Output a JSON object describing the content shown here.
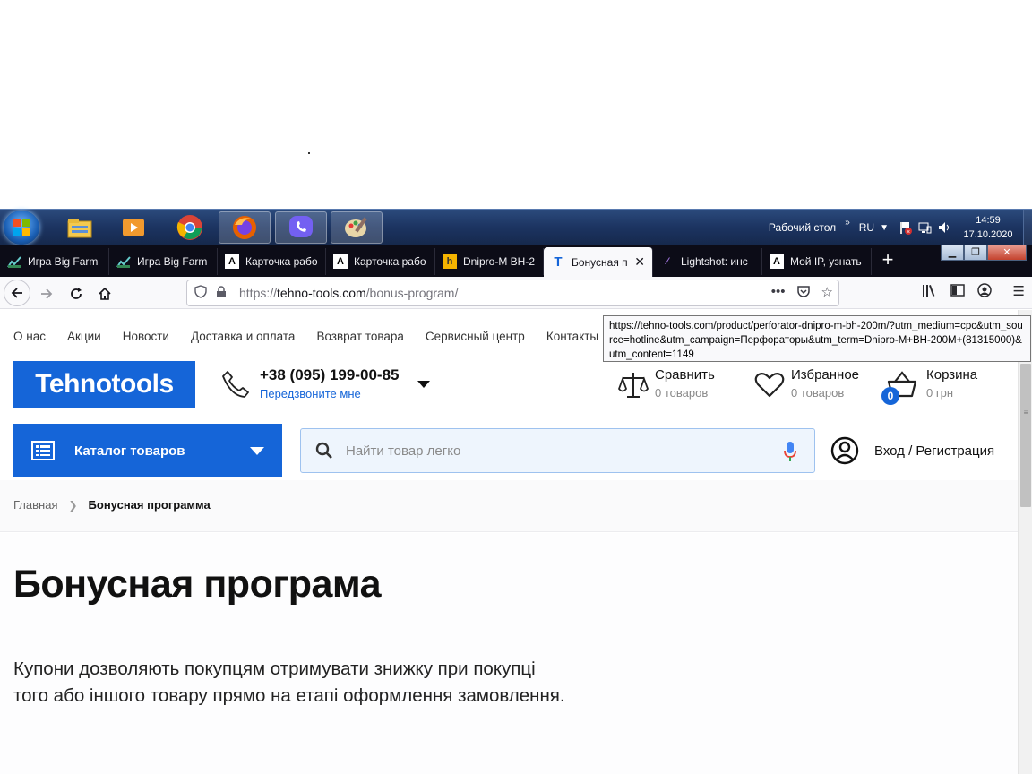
{
  "taskbar": {
    "desktop_label": "Рабочий стол",
    "lang": "RU",
    "time": "14:59",
    "date": "17.10.2020",
    "apps": [
      "explorer-icon",
      "media-player-icon",
      "chrome-icon",
      "firefox-icon",
      "viber-icon",
      "paint-icon"
    ]
  },
  "tabs": [
    {
      "label": "Игра Big Farm",
      "icon": "big-farm-icon"
    },
    {
      "label": "Игра Big Farm",
      "icon": "big-farm-icon"
    },
    {
      "label": "Карточка рабо",
      "icon": "a-icon"
    },
    {
      "label": "Карточка рабо",
      "icon": "a-icon"
    },
    {
      "label": "Dnipro-M BH-2",
      "icon": "h-icon"
    },
    {
      "label": "Бонусная п",
      "icon": "t-icon",
      "active": true
    },
    {
      "label": "Lightshot: инс",
      "icon": "feather-icon"
    },
    {
      "label": "Мой IP, узнать",
      "icon": "a-icon"
    }
  ],
  "urlbar": {
    "proto": "https://",
    "host": "tehno-tools.com",
    "path": "/bonus-program/"
  },
  "tooltip": {
    "text": "https://tehno-tools.com/product/perforator-dnipro-m-bh-200m/?utm_medium=cpc&utm_source=hotline&utm_campaign=Перфораторы&utm_term=Dnipro-M+BH-200M+(81315000)&utm_content=1149"
  },
  "site": {
    "menu": [
      "О нас",
      "Акции",
      "Новости",
      "Доставка и оплата",
      "Возврат товара",
      "Сервисный центр",
      "Контакты"
    ],
    "logo": "Tehnotools",
    "phone": "+38 (095) 199-00-85",
    "callback": "Передзвоните мне",
    "compare": {
      "title": "Сравнить",
      "sub": "0 товаров"
    },
    "favorites": {
      "title": "Избранное",
      "sub": "0 товаров"
    },
    "cart": {
      "title": "Корзина",
      "sub": "0 грн",
      "count": "0"
    },
    "catalog": "Каталог товаров",
    "search_placeholder": "Найти товар легко",
    "login": "Вход / Регистрация",
    "breadcrumb": {
      "home": "Главная",
      "current": "Бонусная программа"
    },
    "title": "Бонусная програма",
    "intro": "Купони дозволяють покупцям отримувати знижку при покупці того або іншого товару прямо на етапі оформлення замовлення."
  },
  "colors": {
    "brand": "#1565d8",
    "tab_bg": "#0c0c17"
  }
}
